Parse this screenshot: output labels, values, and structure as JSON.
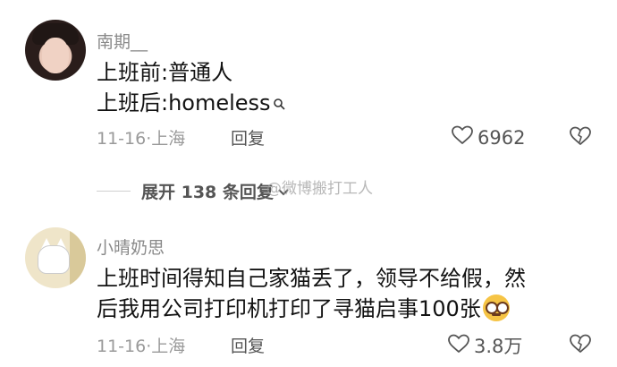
{
  "comments": [
    {
      "username": "南期__",
      "lines": [
        "上班前:普通人",
        "上班后:homeless"
      ],
      "date": "11-16",
      "location": "上海",
      "reply_label": "回复",
      "likes": "6962"
    },
    {
      "username": "小晴奶思",
      "lines": [
        "上班时间得知自己家猫丢了，领导不给假，然",
        "后我用公司打印机打印了寻猫启事100张"
      ],
      "date": "11-16",
      "location": "上海",
      "reply_label": "回复",
      "likes": "3.8万"
    }
  ],
  "expand_replies": {
    "label": "展开 138 条回复"
  },
  "watermark": "@微博搬打工人",
  "icons": {
    "like": "heart-outline-icon",
    "dislike": "broken-heart-icon",
    "search": "search-icon",
    "chevron": "chevron-down-icon",
    "emoji": "dizzy-face-emoji-icon"
  },
  "colors": {
    "text": "#121212",
    "meta": "#9a9a9a",
    "icon": "#555555"
  }
}
